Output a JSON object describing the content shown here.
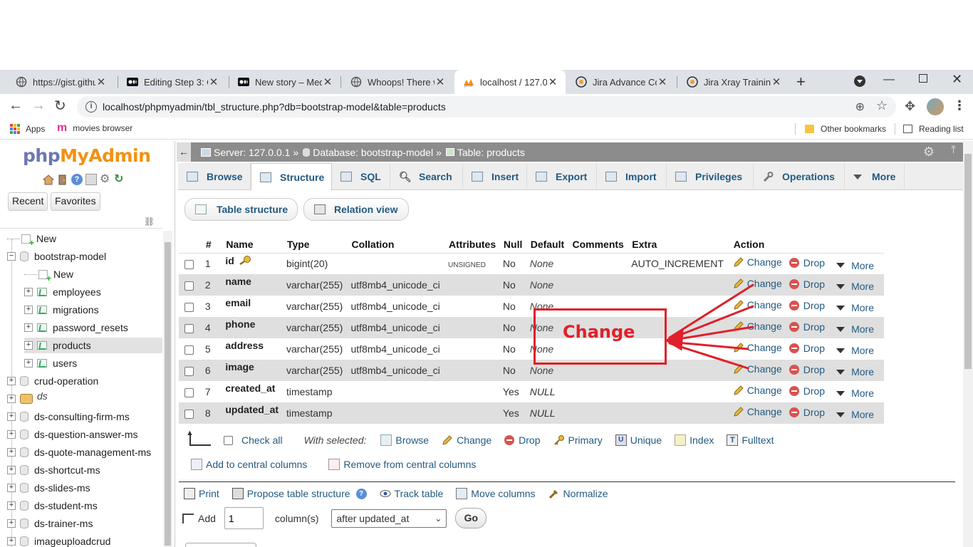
{
  "browser": {
    "tabs": [
      {
        "title": "https://gist.githut",
        "icon": "globe-icon",
        "active": false
      },
      {
        "title": "Editing Step 3: Ge",
        "icon": "medium-icon",
        "active": false
      },
      {
        "title": "New story – Medi",
        "icon": "medium-icon",
        "active": false
      },
      {
        "title": "Whoops! There w",
        "icon": "globe-icon",
        "active": false
      },
      {
        "title": "localhost / 127.0.",
        "icon": "phpmyadmin-icon",
        "active": true
      },
      {
        "title": "Jira Advance Cou",
        "icon": "jira-icon",
        "active": false
      },
      {
        "title": "Jira Xray Training",
        "icon": "jira-icon",
        "active": false
      }
    ],
    "url": "localhost/phpmyadmin/tbl_structure.php?db=bootstrap-model&table=products",
    "bookmarks": {
      "apps": "Apps",
      "movies": "movies browser",
      "other": "Other bookmarks",
      "reading": "Reading list"
    }
  },
  "sidebar": {
    "logo_php": "php",
    "logo_my": "MyAdmin",
    "recent": "Recent",
    "favorites": "Favorites",
    "tree": [
      {
        "label": "New",
        "level": 0,
        "kind": "new"
      },
      {
        "label": "bootstrap-model",
        "level": 0,
        "kind": "db",
        "expanded": true
      },
      {
        "label": "New",
        "level": 1,
        "kind": "new"
      },
      {
        "label": "employees",
        "level": 1,
        "kind": "table"
      },
      {
        "label": "migrations",
        "level": 1,
        "kind": "table"
      },
      {
        "label": "password_resets",
        "level": 1,
        "kind": "table"
      },
      {
        "label": "products",
        "level": 1,
        "kind": "table",
        "selected": true
      },
      {
        "label": "users",
        "level": 1,
        "kind": "table"
      },
      {
        "label": "crud-operation",
        "level": 0,
        "kind": "db"
      },
      {
        "label": "ds",
        "level": 0,
        "kind": "dsgroup"
      },
      {
        "label": "ds-consulting-firm-ms",
        "level": 0,
        "kind": "db"
      },
      {
        "label": "ds-question-answer-ms",
        "level": 0,
        "kind": "db"
      },
      {
        "label": "ds-quote-management-ms",
        "level": 0,
        "kind": "db"
      },
      {
        "label": "ds-shortcut-ms",
        "level": 0,
        "kind": "db"
      },
      {
        "label": "ds-slides-ms",
        "level": 0,
        "kind": "db"
      },
      {
        "label": "ds-student-ms",
        "level": 0,
        "kind": "db"
      },
      {
        "label": "ds-trainer-ms",
        "level": 0,
        "kind": "db"
      },
      {
        "label": "imageuploadcrud",
        "level": 0,
        "kind": "db"
      }
    ]
  },
  "breadcrumb": {
    "server": "Server: 127.0.0.1",
    "database": "Database: bootstrap-model",
    "table": "Table: products",
    "sep": "»"
  },
  "menu": {
    "tabs": [
      {
        "label": "Browse",
        "icon": "browse-icon"
      },
      {
        "label": "Structure",
        "icon": "structure-icon",
        "active": true
      },
      {
        "label": "SQL",
        "icon": "sql-icon"
      },
      {
        "label": "Search",
        "icon": "search-icon"
      },
      {
        "label": "Insert",
        "icon": "insert-icon"
      },
      {
        "label": "Export",
        "icon": "export-icon"
      },
      {
        "label": "Import",
        "icon": "import-icon"
      },
      {
        "label": "Privileges",
        "icon": "privileges-icon"
      },
      {
        "label": "Operations",
        "icon": "wrench-icon"
      },
      {
        "label": "More",
        "icon": "chevron-down-icon"
      }
    ],
    "sub": {
      "table_structure": "Table structure",
      "relation_view": "Relation view"
    }
  },
  "table": {
    "headers": [
      "#",
      "Name",
      "Type",
      "Collation",
      "Attributes",
      "Null",
      "Default",
      "Comments",
      "Extra",
      "Action"
    ],
    "rows": [
      {
        "num": "1",
        "name": "id",
        "primary": true,
        "type": "bigint(20)",
        "collation": "",
        "attributes": "UNSIGNED",
        "null": "No",
        "default": "None",
        "comments": "",
        "extra": "AUTO_INCREMENT"
      },
      {
        "num": "2",
        "name": "name",
        "type": "varchar(255)",
        "collation": "utf8mb4_unicode_ci",
        "attributes": "",
        "null": "No",
        "default": "None",
        "comments": "",
        "extra": ""
      },
      {
        "num": "3",
        "name": "email",
        "type": "varchar(255)",
        "collation": "utf8mb4_unicode_ci",
        "attributes": "",
        "null": "No",
        "default": "None",
        "comments": "",
        "extra": ""
      },
      {
        "num": "4",
        "name": "phone",
        "type": "varchar(255)",
        "collation": "utf8mb4_unicode_ci",
        "attributes": "",
        "null": "No",
        "default": "None",
        "comments": "",
        "extra": ""
      },
      {
        "num": "5",
        "name": "address",
        "type": "varchar(255)",
        "collation": "utf8mb4_unicode_ci",
        "attributes": "",
        "null": "No",
        "default": "None",
        "comments": "",
        "extra": ""
      },
      {
        "num": "6",
        "name": "image",
        "type": "varchar(255)",
        "collation": "utf8mb4_unicode_ci",
        "attributes": "",
        "null": "No",
        "default": "None",
        "comments": "",
        "extra": ""
      },
      {
        "num": "7",
        "name": "created_at",
        "type": "timestamp",
        "collation": "",
        "attributes": "",
        "null": "Yes",
        "default": "NULL",
        "comments": "",
        "extra": ""
      },
      {
        "num": "8",
        "name": "updated_at",
        "type": "timestamp",
        "collation": "",
        "attributes": "",
        "null": "Yes",
        "default": "NULL",
        "comments": "",
        "extra": ""
      }
    ],
    "actions": {
      "change": "Change",
      "drop": "Drop",
      "more": "More"
    }
  },
  "with_selected": {
    "check_all": "Check all",
    "label": "With selected:",
    "items": [
      "Browse",
      "Change",
      "Drop",
      "Primary",
      "Unique",
      "Index",
      "Fulltext"
    ],
    "add_central": "Add to central columns",
    "remove_central": "Remove from central columns"
  },
  "footer": {
    "print": "Print",
    "propose": "Propose table structure",
    "track": "Track table",
    "move": "Move columns",
    "normalize": "Normalize",
    "add": "Add",
    "add_count": "1",
    "columns": "column(s)",
    "position": "after updated_at",
    "go": "Go"
  },
  "annotation": {
    "label": "Change",
    "color": "#e0202a"
  }
}
